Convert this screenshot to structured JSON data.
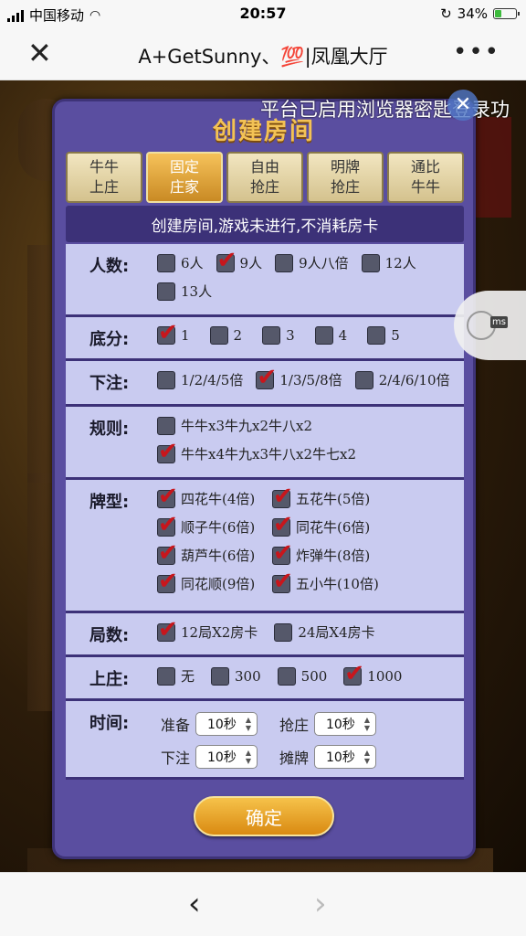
{
  "status_bar": {
    "carrier": "中国移动",
    "time": "20:57",
    "battery": "34%",
    "battery_level": 0.34
  },
  "nav": {
    "title": "A+GetSunny、💯|凤凰大厅",
    "close_icon": "close-icon",
    "more_icon": "more-icon"
  },
  "toast": {
    "text": "平台已启用浏览器密匙登录功"
  },
  "panel": {
    "title": "创建房间",
    "tabs": [
      {
        "line1": "牛牛",
        "line2": "上庄",
        "active": false
      },
      {
        "line1": "固定",
        "line2": "庄家",
        "active": true
      },
      {
        "line1": "自由",
        "line2": "抢庄",
        "active": false
      },
      {
        "line1": "明牌",
        "line2": "抢庄",
        "active": false
      },
      {
        "line1": "通比",
        "line2": "牛牛",
        "active": false
      }
    ],
    "notice": "创建房间,游戏未进行,不消耗房卡",
    "sections": {
      "players": {
        "label": "人数:",
        "options": [
          {
            "text": "6人",
            "checked": false
          },
          {
            "text": "9人",
            "checked": true
          },
          {
            "text": "9人八倍",
            "checked": false
          },
          {
            "text": "12人",
            "checked": false
          },
          {
            "text": "13人",
            "checked": false
          }
        ]
      },
      "base": {
        "label": "底分:",
        "options": [
          {
            "text": "1",
            "checked": true
          },
          {
            "text": "2",
            "checked": false
          },
          {
            "text": "3",
            "checked": false
          },
          {
            "text": "4",
            "checked": false
          },
          {
            "text": "5",
            "checked": false
          }
        ]
      },
      "bet": {
        "label": "下注:",
        "options": [
          {
            "text": "1/2/4/5倍",
            "checked": false
          },
          {
            "text": "1/3/5/8倍",
            "checked": true
          },
          {
            "text": "2/4/6/10倍",
            "checked": false
          }
        ]
      },
      "rules": {
        "label": "规则:",
        "options": [
          {
            "text": "牛牛x3牛九x2牛八x2",
            "checked": false
          },
          {
            "text": "牛牛x4牛九x3牛八x2牛七x2",
            "checked": true
          }
        ]
      },
      "hands": {
        "label": "牌型:",
        "options": [
          {
            "text": "四花牛(4倍)",
            "checked": true
          },
          {
            "text": "五花牛(5倍)",
            "checked": true
          },
          {
            "text": "顺子牛(6倍)",
            "checked": true
          },
          {
            "text": "同花牛(6倍)",
            "checked": true
          },
          {
            "text": "葫芦牛(6倍)",
            "checked": true
          },
          {
            "text": "炸弹牛(8倍)",
            "checked": true
          },
          {
            "text": "同花顺(9倍)",
            "checked": true
          },
          {
            "text": "五小牛(10倍)",
            "checked": true
          }
        ]
      },
      "rounds": {
        "label": "局数:",
        "options": [
          {
            "text": "12局X2房卡",
            "checked": true
          },
          {
            "text": "24局X4房卡",
            "checked": false
          }
        ]
      },
      "banker": {
        "label": "上庄:",
        "options": [
          {
            "text": "无",
            "checked": false
          },
          {
            "text": "300",
            "checked": false
          },
          {
            "text": "500",
            "checked": false
          },
          {
            "text": "1000",
            "checked": true
          }
        ]
      },
      "time": {
        "label": "时间:",
        "items": [
          {
            "label": "准备",
            "value": "10秒"
          },
          {
            "label": "抢庄",
            "value": "10秒"
          },
          {
            "label": "下注",
            "value": "10秒"
          },
          {
            "label": "摊牌",
            "value": "10秒"
          }
        ]
      }
    },
    "confirm_label": "确定"
  },
  "bottom_bar": {
    "back_icon": "back-arrow-icon",
    "forward_icon": "forward-arrow-icon"
  },
  "colors": {
    "panel": "#5a4ea0",
    "section": "#c9cbf0",
    "accent_gold": "#f3c255",
    "check_red": "#c8161c"
  }
}
